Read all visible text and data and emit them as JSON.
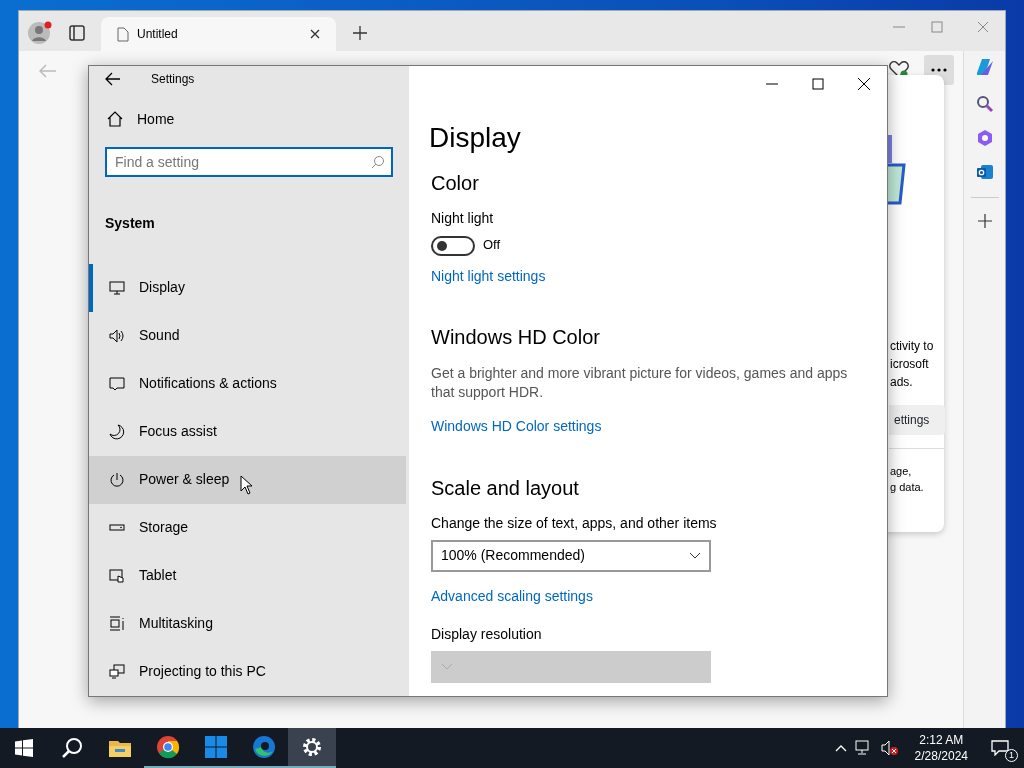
{
  "browser": {
    "tab": {
      "title": "Untitled"
    },
    "side_panel": {
      "lines": [
        "ctivity to",
        "icrosoft",
        "ads."
      ],
      "button": "ettings",
      "footer_lines": [
        "age,",
        "g data."
      ]
    }
  },
  "settings": {
    "title": "Settings",
    "home": "Home",
    "search": {
      "placeholder": "Find a setting"
    },
    "group": "System",
    "nav": [
      {
        "label": "Display",
        "selected": true,
        "hovered": false
      },
      {
        "label": "Sound",
        "selected": false,
        "hovered": false
      },
      {
        "label": "Notifications & actions",
        "selected": false,
        "hovered": false
      },
      {
        "label": "Focus assist",
        "selected": false,
        "hovered": false
      },
      {
        "label": "Power & sleep",
        "selected": false,
        "hovered": true
      },
      {
        "label": "Storage",
        "selected": false,
        "hovered": false
      },
      {
        "label": "Tablet",
        "selected": false,
        "hovered": false
      },
      {
        "label": "Multitasking",
        "selected": false,
        "hovered": false
      },
      {
        "label": "Projecting to this PC",
        "selected": false,
        "hovered": false
      }
    ],
    "page_title": "Display",
    "content": [
      {
        "kind": "heading",
        "text": "Color"
      },
      {
        "kind": "label",
        "text": "Night light"
      },
      {
        "kind": "toggle",
        "on": false,
        "text": "Off"
      },
      {
        "kind": "link",
        "text": "Night light settings"
      },
      {
        "kind": "heading",
        "text": "Windows HD Color"
      },
      {
        "kind": "text",
        "text": "Get a brighter and more vibrant picture for videos, games and apps that support HDR."
      },
      {
        "kind": "link",
        "text": "Windows HD Color settings"
      },
      {
        "kind": "heading",
        "text": "Scale and layout"
      },
      {
        "kind": "label",
        "text": "Change the size of text, apps, and other items"
      },
      {
        "kind": "dropdown",
        "text": "100% (Recommended)",
        "disabled": false
      },
      {
        "kind": "link",
        "text": "Advanced scaling settings"
      },
      {
        "kind": "label",
        "text": "Display resolution"
      },
      {
        "kind": "dropdown",
        "disabled": true
      }
    ]
  },
  "taskbar": {
    "apps": [
      {
        "running": false,
        "active": false
      },
      {
        "running": true,
        "active": false
      },
      {
        "running": true,
        "active": false
      },
      {
        "running": true,
        "active": false
      },
      {
        "running": true,
        "active": true
      }
    ],
    "time": "2:12 AM",
    "date": "2/28/2024",
    "notifications": "1"
  }
}
